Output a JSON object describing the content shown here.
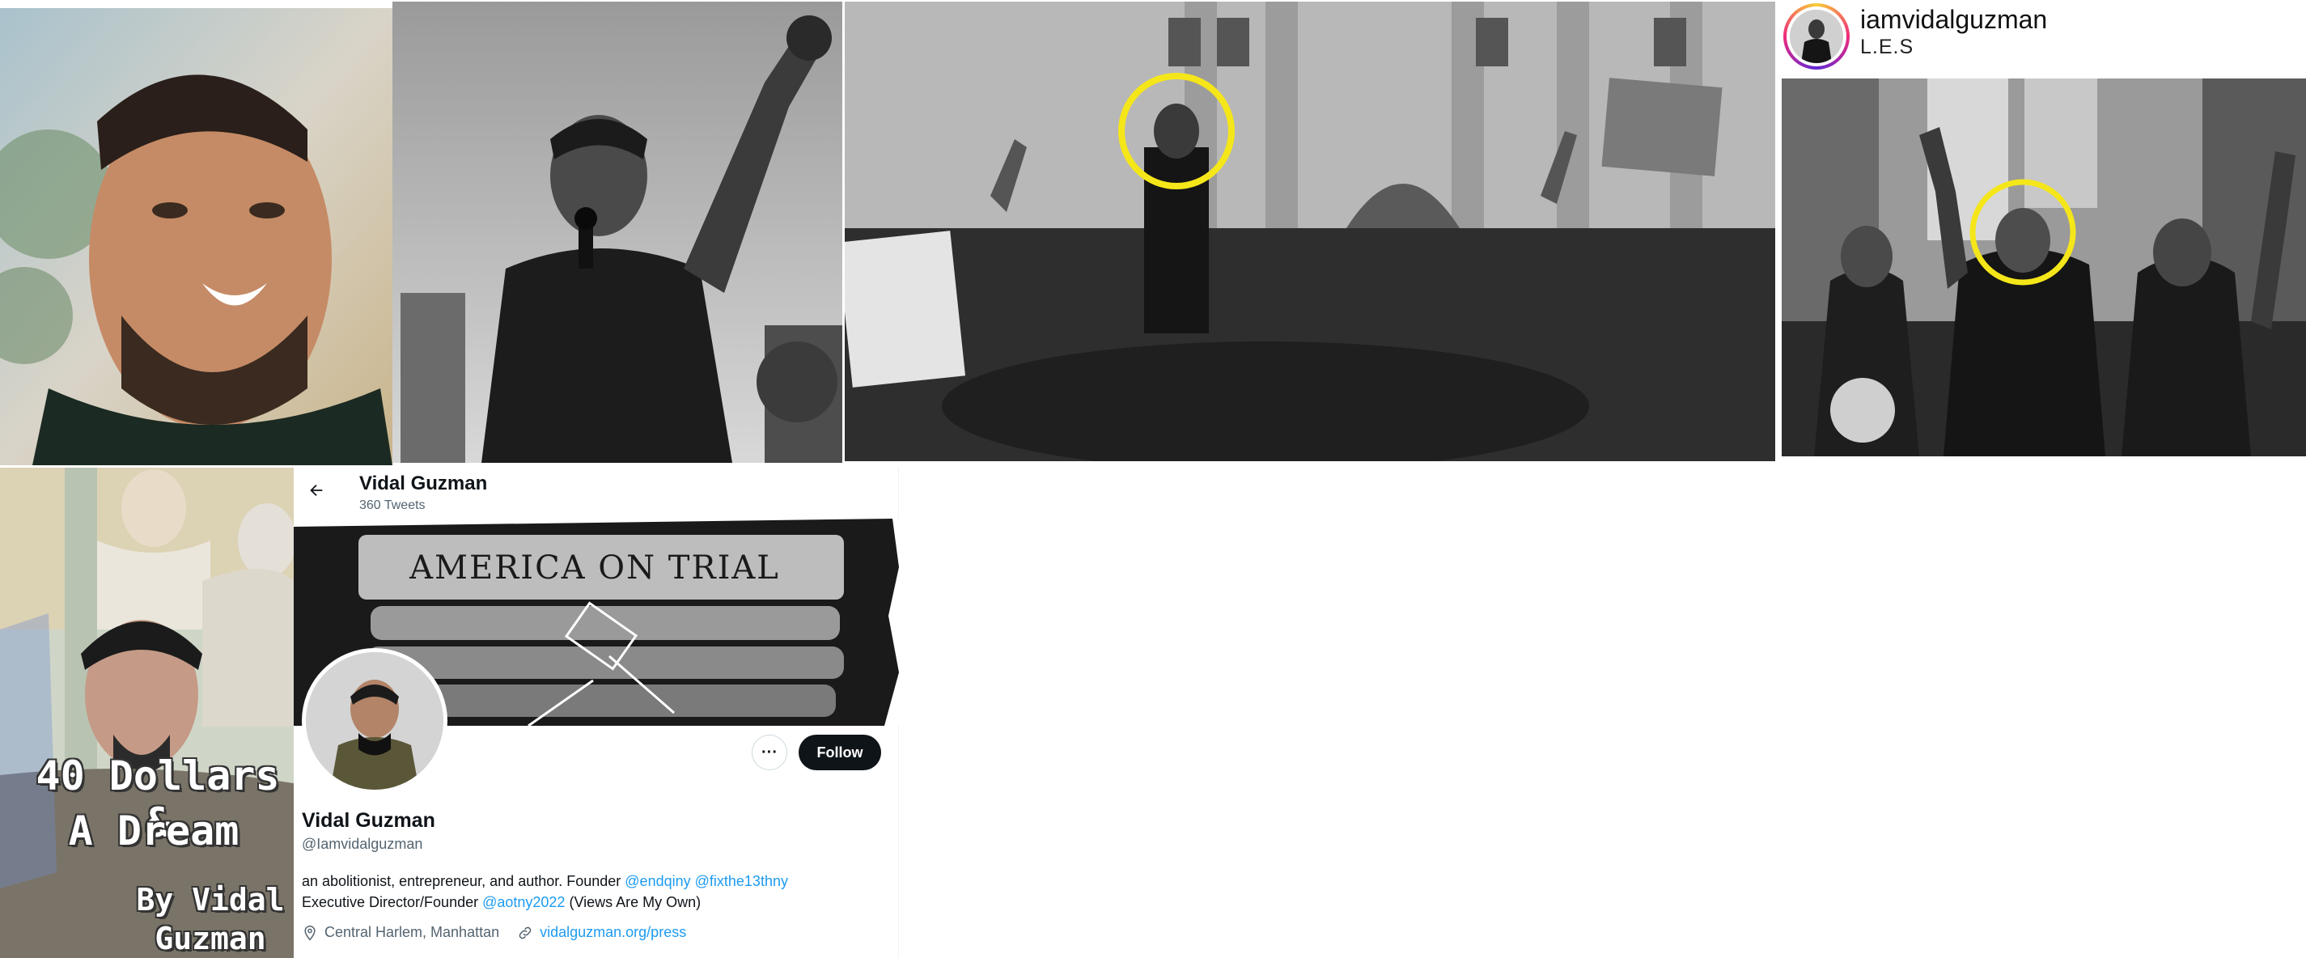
{
  "instagram": {
    "username": "iamvidalguzman",
    "location": "L.E.S"
  },
  "book_cover": {
    "title_line_1": "40 Dollars &",
    "title_line_2": "A Dream",
    "author_line_1": "By Vidal",
    "author_line_2": "Guzman"
  },
  "twitter": {
    "header_name": "Vidal Guzman",
    "tweet_count": "360 Tweets",
    "banner_text": "AMERICA ON TRIAL",
    "more_label": "···",
    "follow_label": "Follow",
    "display_name": "Vidal Guzman",
    "handle": "@Iamvidalguzman",
    "bio": {
      "line1_text": "an abolitionist, entrepreneur, and author. Founder ",
      "mention_1": "@endqiny",
      "mention_2": "@fixthe13thny",
      "line2_text": "Executive Director/Founder ",
      "mention_3": "@aotny2022",
      "line2_tail": " (Views Are My Own)"
    },
    "location": "Central Harlem, Manhattan",
    "website": "vidalguzman.org/press"
  },
  "colors": {
    "link": "#1d9bf0",
    "follow_bg": "#0f1419",
    "highlight_circle": "#f5e61a"
  },
  "icons": {
    "back": "arrow-left-icon",
    "location": "map-pin-icon",
    "website": "link-icon"
  }
}
